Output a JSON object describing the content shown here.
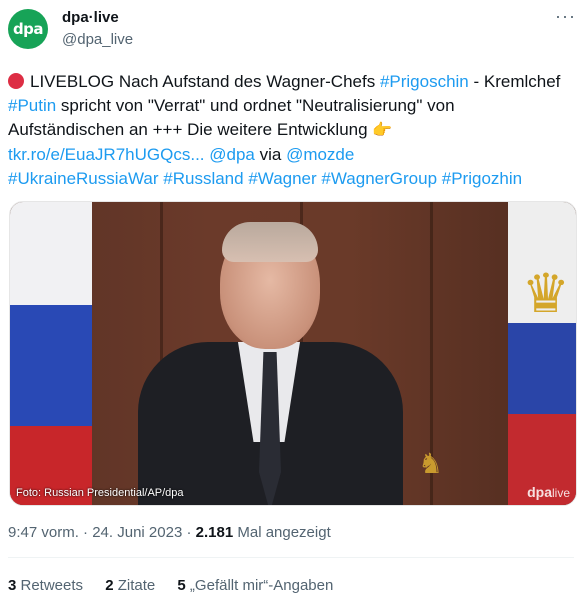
{
  "author": {
    "avatar_text": "dpa",
    "name": "dpa·live",
    "handle": "@dpa_live",
    "more_label": "···"
  },
  "tweet": {
    "prefix": "LIVEBLOG Nach Aufstand des Wagner-Chefs ",
    "tag_prigoschin": "#Prigoschin",
    "mid1": " - Kremlchef ",
    "tag_putin": "#Putin",
    "mid2": " spricht von \"Verrat\" und ordnet \"Neutralisierung\" von Aufständischen an +++ Die weitere Entwicklung ",
    "emoji": "👉",
    "link_url": "tkr.ro/e/EuaJR7hUGQcs...",
    "mention_dpa": "@dpa",
    "via": " via ",
    "mention_mozde": "@mozde",
    "hashtags": [
      "#UkraineRussiaWar",
      "#Russland",
      "#Wagner",
      "#WagnerGroup",
      "#Prigozhin"
    ]
  },
  "media": {
    "credit": "Foto: Russian Presidential/AP/dpa",
    "watermark_main": "dpa",
    "watermark_sub": "live"
  },
  "meta": {
    "time": "9:47 vorm.",
    "sep1": " · ",
    "date": "24. Juni 2023",
    "sep2": " · ",
    "views": "2.181",
    "views_label": " Mal angezeigt"
  },
  "stats": {
    "retweets_count": "3",
    "retweets_label": " Retweets",
    "quotes_count": "2",
    "quotes_label": " Zitate",
    "likes_count": "5",
    "likes_label": " „Gefällt mir“-Angaben"
  },
  "colors": {
    "accent": "#1d9bf0",
    "avatar_bg": "#17a357",
    "live_dot": "#dd2e44"
  }
}
